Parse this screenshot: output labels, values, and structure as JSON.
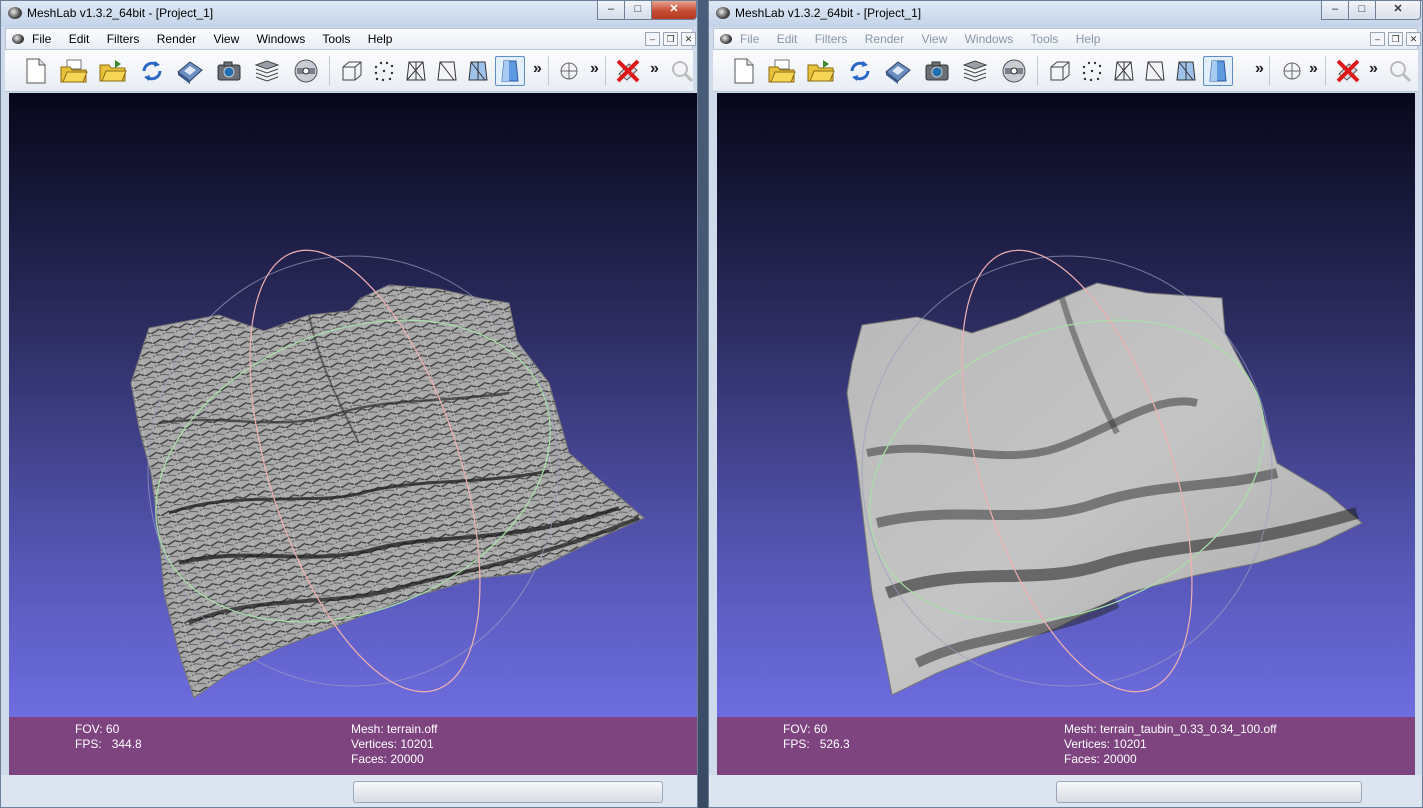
{
  "windows": [
    {
      "title": "MeshLab v1.3.2_64bit - [Project_1]",
      "menu": [
        "File",
        "Edit",
        "Filters",
        "Render",
        "View",
        "Windows",
        "Tools",
        "Help"
      ],
      "window_controls": {
        "minimize": "–",
        "maximize": "□",
        "close": "✕"
      },
      "mdi_controls": {
        "minimize": "–",
        "restore": "❐",
        "close": "✕"
      },
      "toolbar_more": "»",
      "info": {
        "fov": "FOV: 60",
        "fps_label": "FPS:",
        "fps_value": "344.8",
        "mesh": "Mesh: terrain.off",
        "vertices": "Vertices: 10201",
        "faces": "Faces: 20000"
      }
    },
    {
      "title": "MeshLab v1.3.2_64bit - [Project_1]",
      "menu": [
        "File",
        "Edit",
        "Filters",
        "Render",
        "View",
        "Windows",
        "Tools",
        "Help"
      ],
      "window_controls": {
        "minimize": "–",
        "maximize": "□",
        "close": "✕"
      },
      "mdi_controls": {
        "minimize": "–",
        "restore": "❐",
        "close": "✕"
      },
      "toolbar_more": "»",
      "info": {
        "fov": "FOV: 60",
        "fps_label": "FPS:",
        "fps_value": "526.3",
        "mesh": "Mesh: terrain_taubin_0.33_0.34_100.off",
        "vertices": "Vertices: 10201",
        "faces": "Faces: 20000"
      }
    }
  ],
  "toolbar_icons": [
    "new-project-icon",
    "open-project-icon",
    "open-mesh-icon",
    "reload-icon",
    "save-icon",
    "snapshot-icon",
    "layers-icon",
    "raster-icon",
    "bounding-box-icon",
    "points-icon",
    "wireframe-icon",
    "hidden-lines-icon",
    "flat-lines-icon",
    "flat-shading-icon",
    "light-icon",
    "delete-icon",
    "search-icon"
  ],
  "colors": {
    "viewport_top": "#07071a",
    "viewport_bottom": "#6d6de0",
    "info_bar": "#7d4480",
    "active_close": "#c64b33"
  }
}
